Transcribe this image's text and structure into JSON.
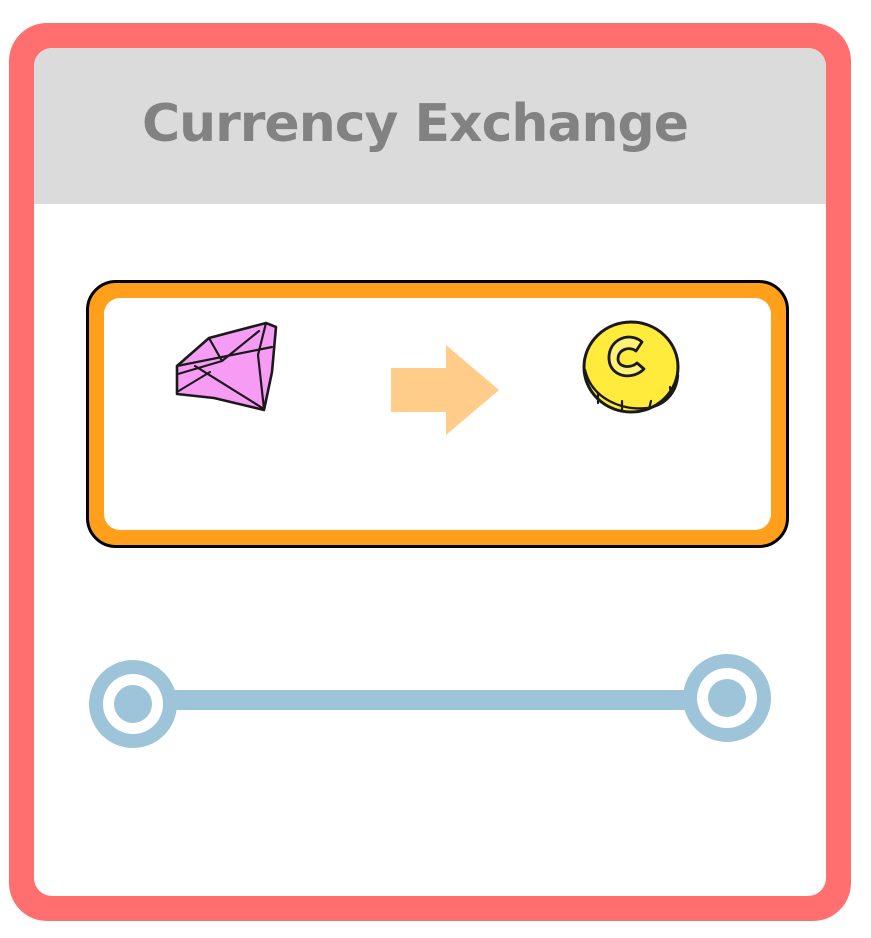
{
  "dialog": {
    "title": "Currency Exchange"
  },
  "exchange": {
    "from_icon": "gem-icon",
    "direction_icon": "arrow-right-icon",
    "to_icon": "coin-icon"
  },
  "amount_slider": {
    "position": "minimum"
  },
  "colors": {
    "frame": "#ff6f6f",
    "header": "#dbdbdb",
    "title_text": "#828282",
    "card_border": "#ff9f1c",
    "arrow": "#ffcc8a",
    "gem": "#f79cf5",
    "coin": "#ffeb3b",
    "slider": "#9ec4d9"
  }
}
